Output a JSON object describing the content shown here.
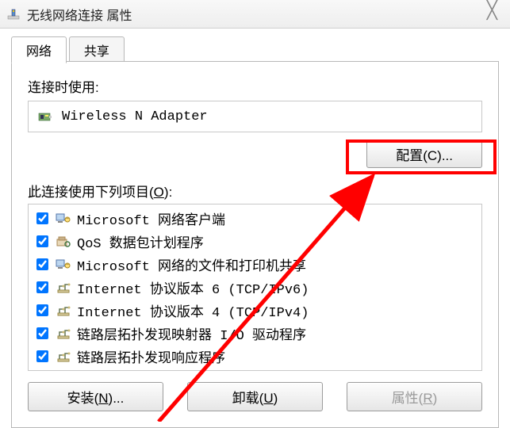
{
  "window": {
    "title": "无线网络连接 属性",
    "close": "✕"
  },
  "tabs": {
    "networking": "网络",
    "sharing": "共享"
  },
  "connectUsing": {
    "label": "连接时使用:",
    "adapterName": "Wireless N Adapter"
  },
  "configure": {
    "label": "配置(C)..."
  },
  "components": {
    "label_pre": "此连接使用下列项目(",
    "label_u": "O",
    "label_post": "):",
    "items": [
      {
        "checked": true,
        "icon": "client",
        "label": "Microsoft 网络客户端"
      },
      {
        "checked": true,
        "icon": "qos",
        "label": "QoS 数据包计划程序"
      },
      {
        "checked": true,
        "icon": "client",
        "label": "Microsoft 网络的文件和打印机共享"
      },
      {
        "checked": true,
        "icon": "protocol",
        "label": "Internet 协议版本 6 (TCP/IPv6)"
      },
      {
        "checked": true,
        "icon": "protocol",
        "label": "Internet 协议版本 4 (TCP/IPv4)"
      },
      {
        "checked": true,
        "icon": "protocol",
        "label": "链路层拓扑发现映射器 I/O 驱动程序"
      },
      {
        "checked": true,
        "icon": "protocol",
        "label": "链路层拓扑发现响应程序"
      }
    ]
  },
  "buttons": {
    "install_pre": "安装(",
    "install_u": "N",
    "install_post": ")...",
    "uninstall_pre": "卸载(",
    "uninstall_u": "U",
    "uninstall_post": ")",
    "properties_pre": "属性(",
    "properties_u": "R",
    "properties_post": ")"
  }
}
